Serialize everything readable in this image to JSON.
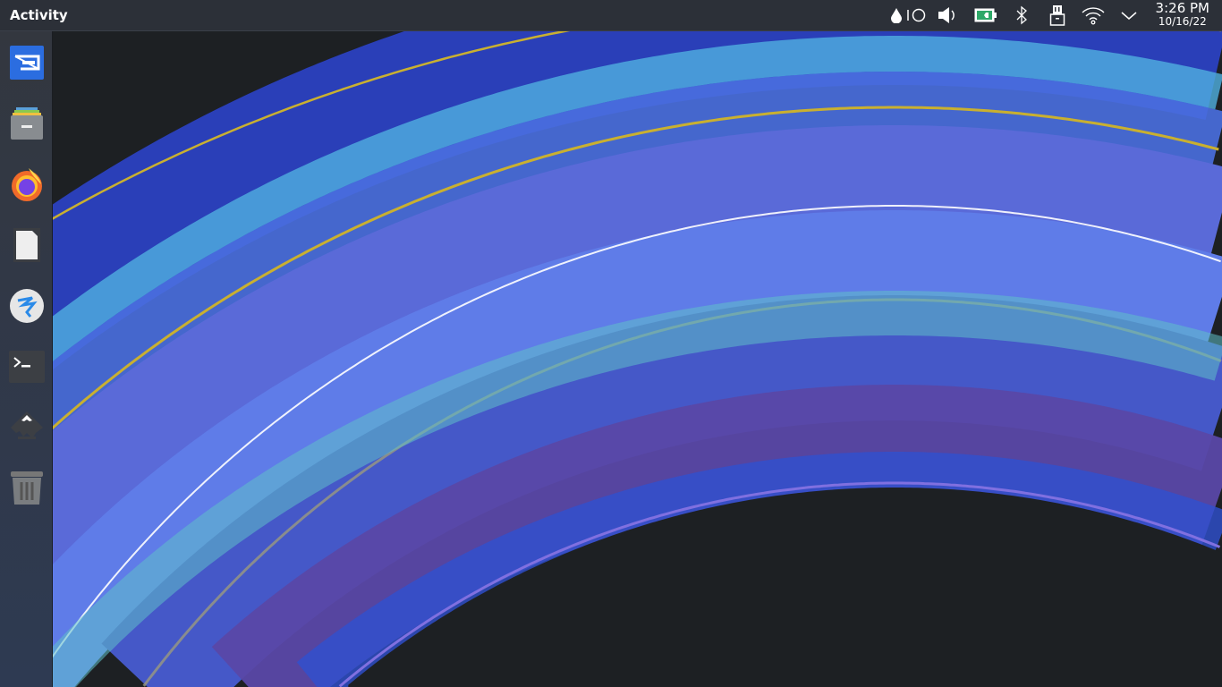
{
  "topbar": {
    "activity_label": "Activity",
    "tray": [
      {
        "icon": "drop-icon"
      },
      {
        "icon": "circle-icon"
      },
      {
        "icon": "volume-icon"
      },
      {
        "icon": "battery-charging-icon"
      },
      {
        "icon": "bluetooth-icon"
      },
      {
        "icon": "usb-drive-icon"
      },
      {
        "icon": "wifi-icon"
      },
      {
        "icon": "chevron-down-icon"
      }
    ],
    "clock": {
      "time": "3:26 PM",
      "date": "10/16/22"
    }
  },
  "dock": {
    "apps": [
      {
        "name": "screenshot-tool"
      },
      {
        "name": "file-manager"
      },
      {
        "name": "firefox"
      },
      {
        "name": "document-viewer"
      },
      {
        "name": "kde-app"
      },
      {
        "name": "terminal"
      },
      {
        "name": "inkscape"
      },
      {
        "name": "trash"
      }
    ]
  },
  "colors": {
    "topbar": "#2c3038",
    "dock": "#33373f",
    "accent": "#2f6fe0"
  }
}
